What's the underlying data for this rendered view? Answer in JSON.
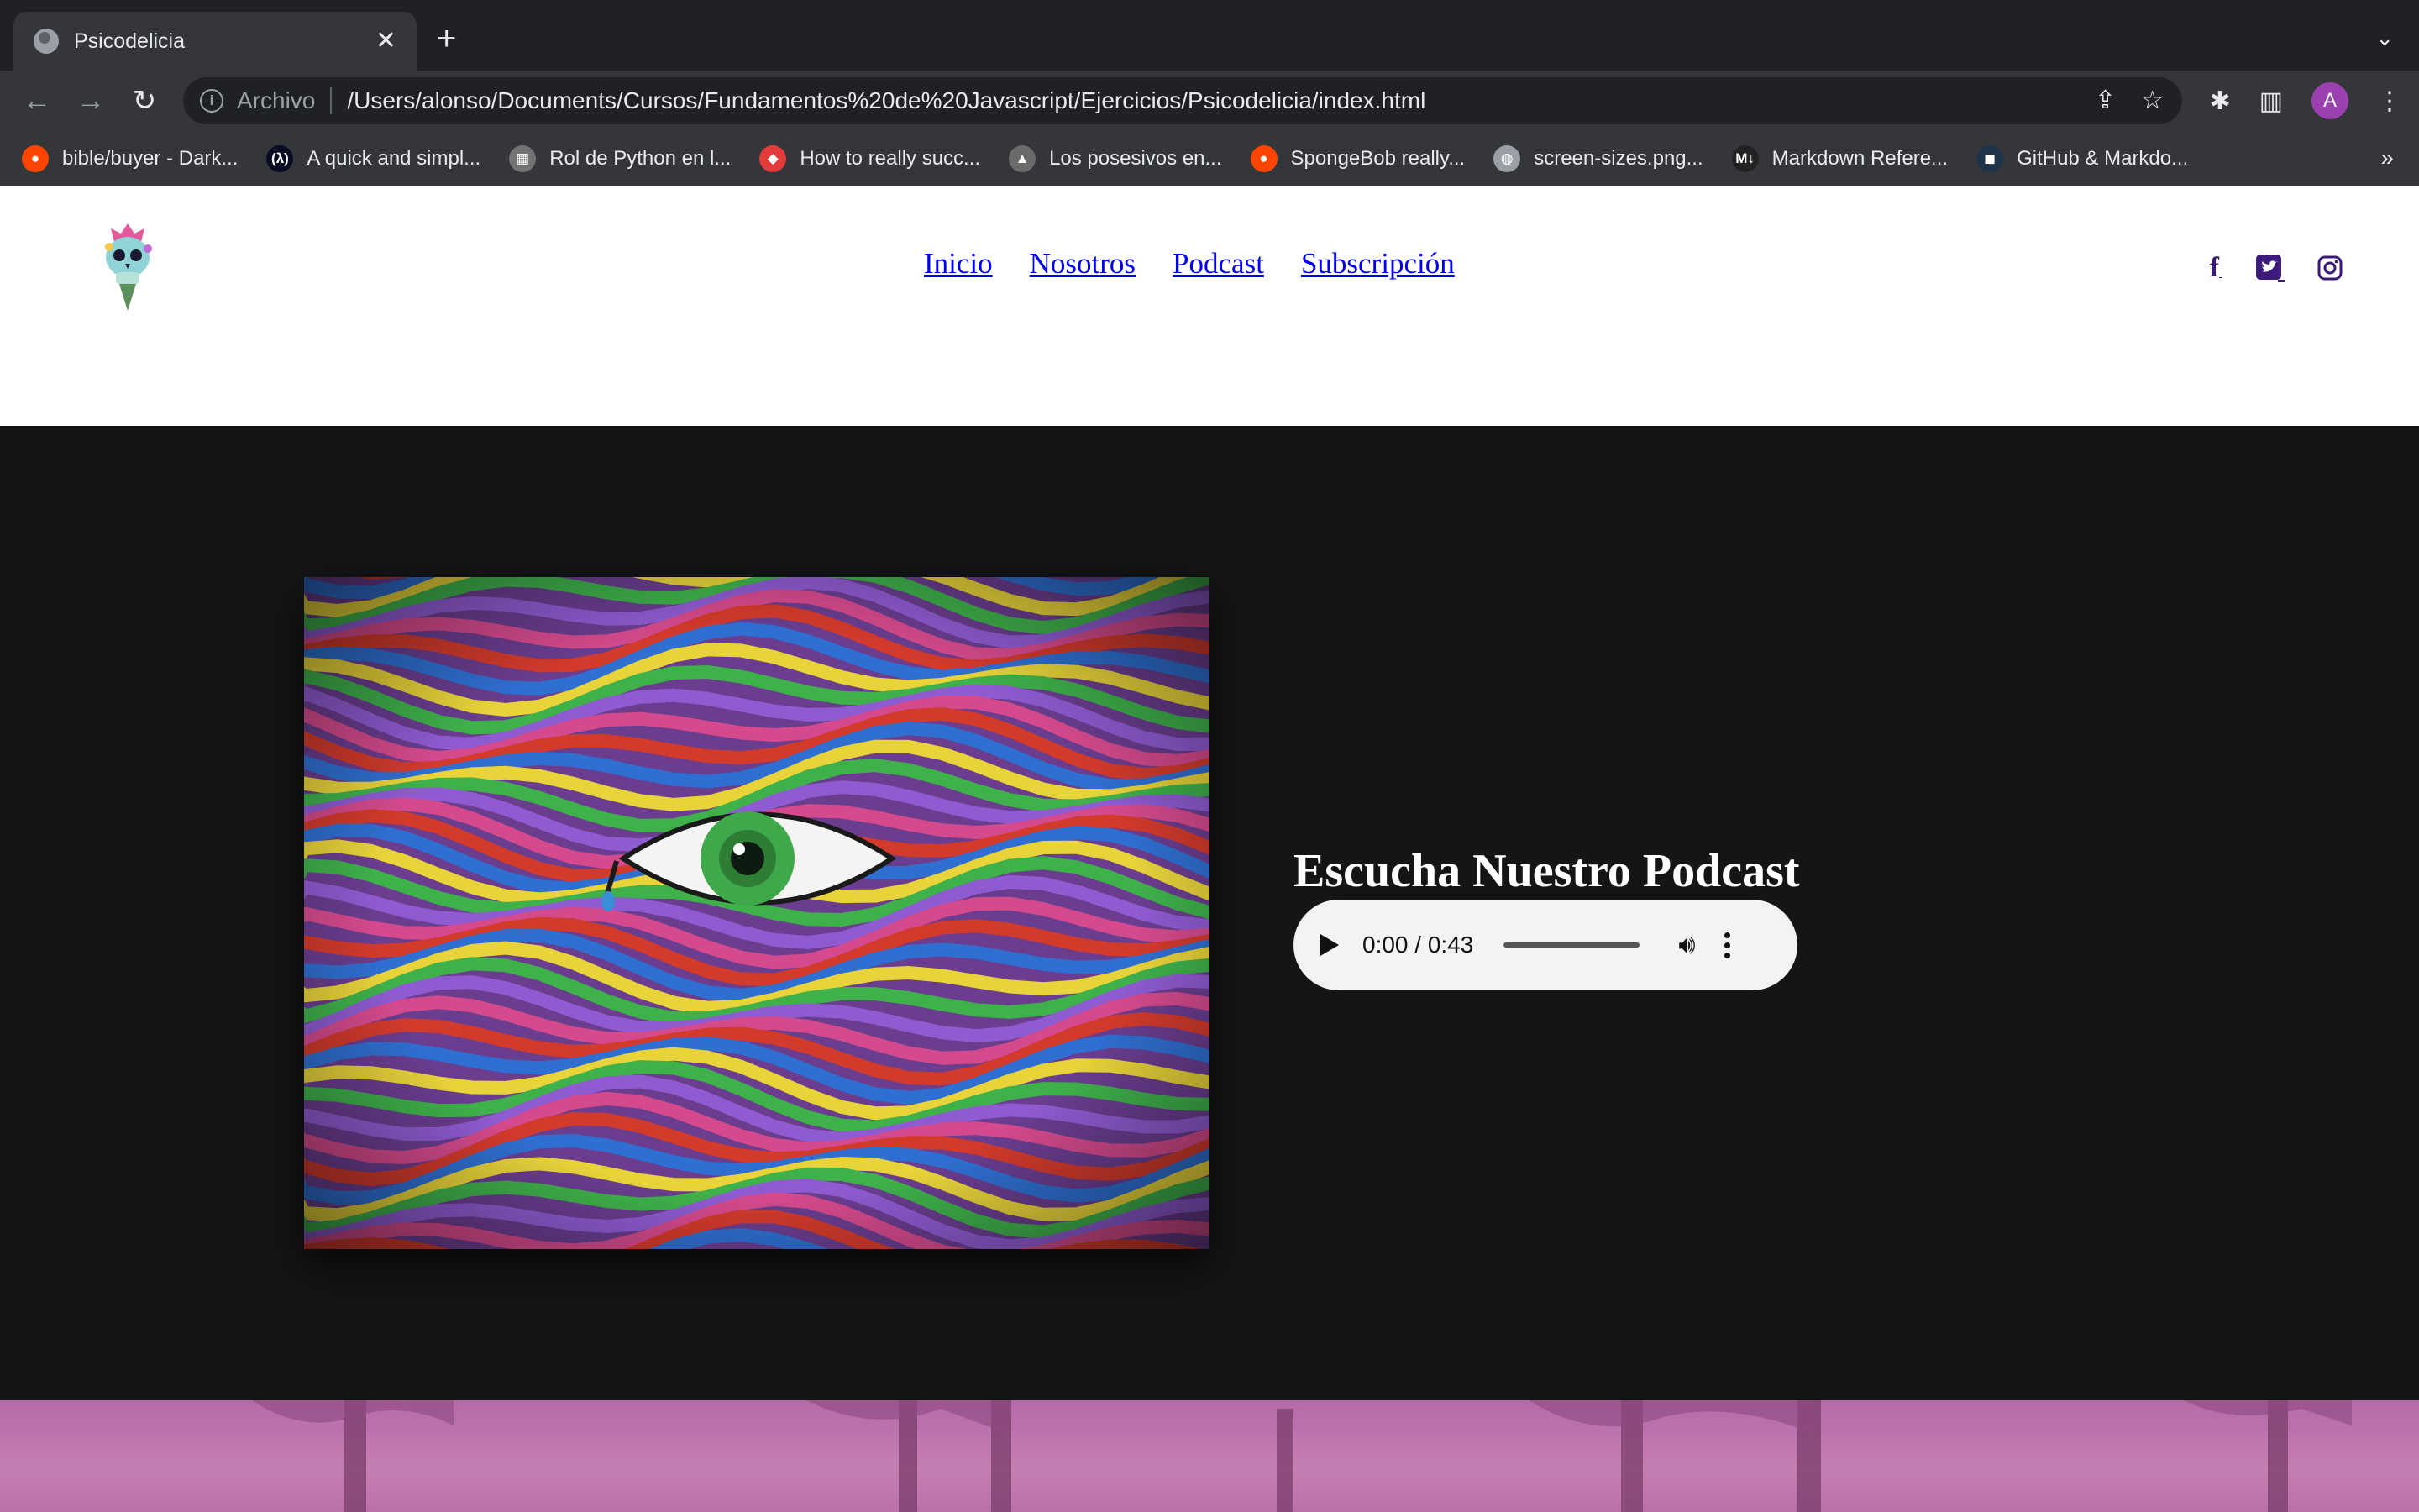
{
  "browser": {
    "tab_title": "Psicodelicia",
    "omnibox": {
      "label": "Archivo",
      "url": "/Users/alonso/Documents/Cursos/Fundamentos%20de%20Javascript/Ejercicios/Psicodelicia/index.html"
    },
    "profile_initial": "A",
    "bookmarks": [
      {
        "label": "bible/buyer - Dark...",
        "icon": "reddit-icon",
        "color": "#ff4500"
      },
      {
        "label": "A quick and simpl...",
        "icon": "freecodecamp-icon",
        "color": "#0a0a23"
      },
      {
        "label": "Rol de Python en l...",
        "icon": "microsoft-icon",
        "color": "#737373"
      },
      {
        "label": "How to really succ...",
        "icon": "pill-icon",
        "color": "#e33b3b"
      },
      {
        "label": "Los posesivos en...",
        "icon": "shark-icon",
        "color": "#6b6b6b"
      },
      {
        "label": "SpongeBob really...",
        "icon": "reddit-icon",
        "color": "#ff4500"
      },
      {
        "label": "screen-sizes.png...",
        "icon": "globe-icon",
        "color": "#9aa0a6"
      },
      {
        "label": "Markdown Refere...",
        "icon": "markdown-icon",
        "color": "#222222"
      },
      {
        "label": "GitHub & Markdo...",
        "icon": "github-icon",
        "color": "#1f3349"
      }
    ]
  },
  "site": {
    "nav": [
      "Inicio",
      "Nosotros",
      "Podcast",
      "Subscripción"
    ],
    "social_icons": [
      "facebook-icon",
      "twitter-icon",
      "instagram-icon"
    ],
    "podcast": {
      "title": "Escucha Nuestro Podcast",
      "player_time": "0:00 / 0:43"
    }
  },
  "colors": {
    "chrome_dark": "#202124",
    "chrome_toolbar": "#35363a",
    "page_dark": "#141517",
    "link": "#0000ee",
    "social": "#3b1a7a",
    "footer_band": "#c47fb2"
  }
}
